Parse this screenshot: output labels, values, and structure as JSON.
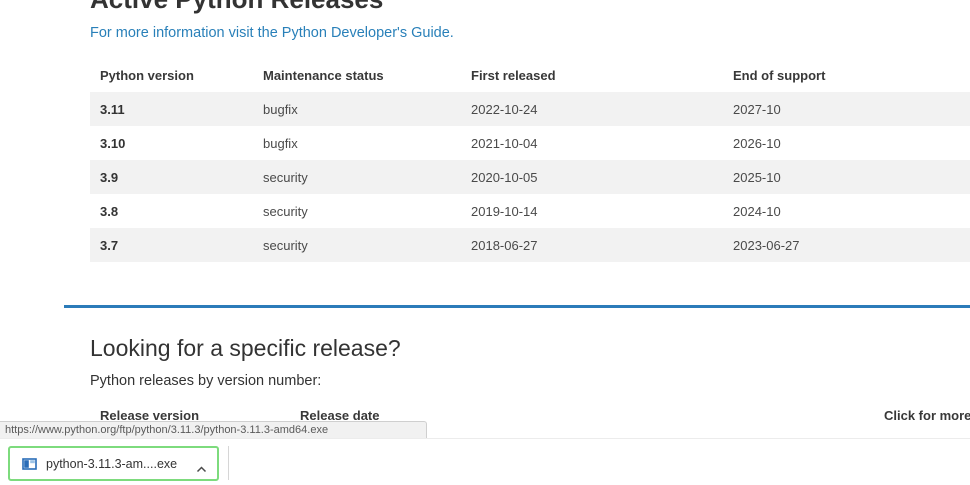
{
  "active_releases": {
    "heading": "Active Python Releases",
    "info_link": "For more information visit the Python Developer's Guide.",
    "table": {
      "headers": [
        "Python version",
        "Maintenance status",
        "First released",
        "End of support"
      ],
      "rows": [
        [
          "3.11",
          "bugfix",
          "2022-10-24",
          "2027-10"
        ],
        [
          "3.10",
          "bugfix",
          "2021-10-04",
          "2026-10"
        ],
        [
          "3.9",
          "security",
          "2020-10-05",
          "2025-10"
        ],
        [
          "3.8",
          "security",
          "2019-10-14",
          "2024-10"
        ],
        [
          "3.7",
          "security",
          "2018-06-27",
          "2023-06-27"
        ]
      ]
    }
  },
  "specific_release": {
    "heading": "Looking for a specific release?",
    "subtitle": "Python releases by version number:",
    "col_release_version": "Release version",
    "col_release_date": "Release date",
    "col_click_for_more": "Click for more"
  },
  "status_bar": {
    "url": "https://www.python.org/ftp/python/3.11.3/python-3.11.3-amd64.exe"
  },
  "download_shelf": {
    "filename": "python-3.11.3-am....exe",
    "icons": {
      "file": "installer-icon",
      "menu": "chevron-up-icon"
    }
  },
  "colors": {
    "link_blue": "#2980b9",
    "divider_blue": "#2b7bb9",
    "row_stripe": "#f2f2f2",
    "highlight_green": "#7ddb7d"
  }
}
